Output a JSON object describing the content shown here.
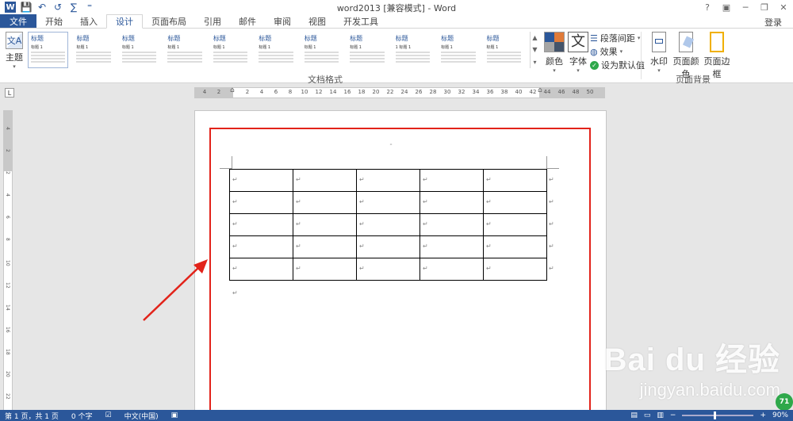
{
  "window": {
    "title": "word2013 [兼容模式] - Word",
    "help": "?",
    "restore_ribbon": "▣",
    "minimize": "─",
    "maximize": "❐",
    "close": "✕"
  },
  "qat": {
    "save": "💾",
    "undo": "↶",
    "redo": "↺",
    "sum": "∑",
    "more": "⁼"
  },
  "tabs": [
    "文件",
    "开始",
    "插入",
    "设计",
    "页面布局",
    "引用",
    "邮件",
    "审阅",
    "视图",
    "开发工具"
  ],
  "login": "登录",
  "ribbon": {
    "theme_label": "主题",
    "theme_icon_text": "文A",
    "styles": [
      {
        "title": "标题",
        "sub": "标题 1"
      },
      {
        "title": "标题",
        "sub": "标题 1"
      },
      {
        "title": "标题",
        "sub": "标题 1"
      },
      {
        "title": "标题",
        "sub": "标题 1"
      },
      {
        "title": "标题",
        "sub": "标题 1"
      },
      {
        "title": "标题",
        "sub": "标题 1"
      },
      {
        "title": "标题",
        "sub": "标题 1"
      },
      {
        "title": "标题",
        "sub": "标题 1"
      },
      {
        "title": "标题",
        "sub": "1 标题 1"
      },
      {
        "title": "标题",
        "sub": "标题 1"
      },
      {
        "title": "标题",
        "sub": "标题 1"
      }
    ],
    "doc_format_label": "文档格式",
    "colors_label": "颜色",
    "fonts_label": "字体",
    "fonts_icon": "文",
    "paragraph_spacing": "段落间距",
    "effects": "效果",
    "set_default": "设为默认值",
    "watermark_label": "水印",
    "page_color_label": "页面颜色",
    "page_border_label": "页面边框",
    "page_background_label": "页面背景"
  },
  "ruler": {
    "corner": "L",
    "ticks": [
      "4",
      "2",
      "2",
      "4",
      "6",
      "8",
      "10",
      "12",
      "14",
      "16",
      "18",
      "20",
      "22",
      "24",
      "26",
      "28",
      "30",
      "32",
      "34",
      "36",
      "38",
      "40",
      "42",
      "44",
      "46",
      "48",
      "50"
    ],
    "vticks": [
      "4",
      "2",
      "2",
      "4",
      "6",
      "8",
      "10",
      "12",
      "14",
      "16",
      "18",
      "20",
      "22"
    ]
  },
  "document": {
    "header_mark": "⁃",
    "cell_mark": "↵",
    "rows": [
      [
        "↵",
        "↵",
        "↵",
        "↵",
        "↵"
      ],
      [
        "↵",
        "↵",
        "↵",
        "↵",
        "↵"
      ],
      [
        "↵",
        "↵",
        "↵",
        "↵",
        "↵"
      ],
      [
        "↵",
        "↵",
        "↵",
        "↵",
        "↵"
      ],
      [
        "↵",
        "↵",
        "↵",
        "↵",
        "↵"
      ]
    ],
    "para_mark": "↵"
  },
  "watermark": {
    "logo": "Bai du 经验",
    "url": "jingyan.baidu.com"
  },
  "status": {
    "page": "第 1 页，共 1 页",
    "words": "0 个字",
    "lang": "中文(中国)",
    "zoom": "90%",
    "zoom_minus": "−",
    "zoom_plus": "+",
    "badge": "71"
  },
  "colors": {
    "accent": "#2b579a",
    "highlight": "#e2231a",
    "badge": "#2ea84a"
  }
}
